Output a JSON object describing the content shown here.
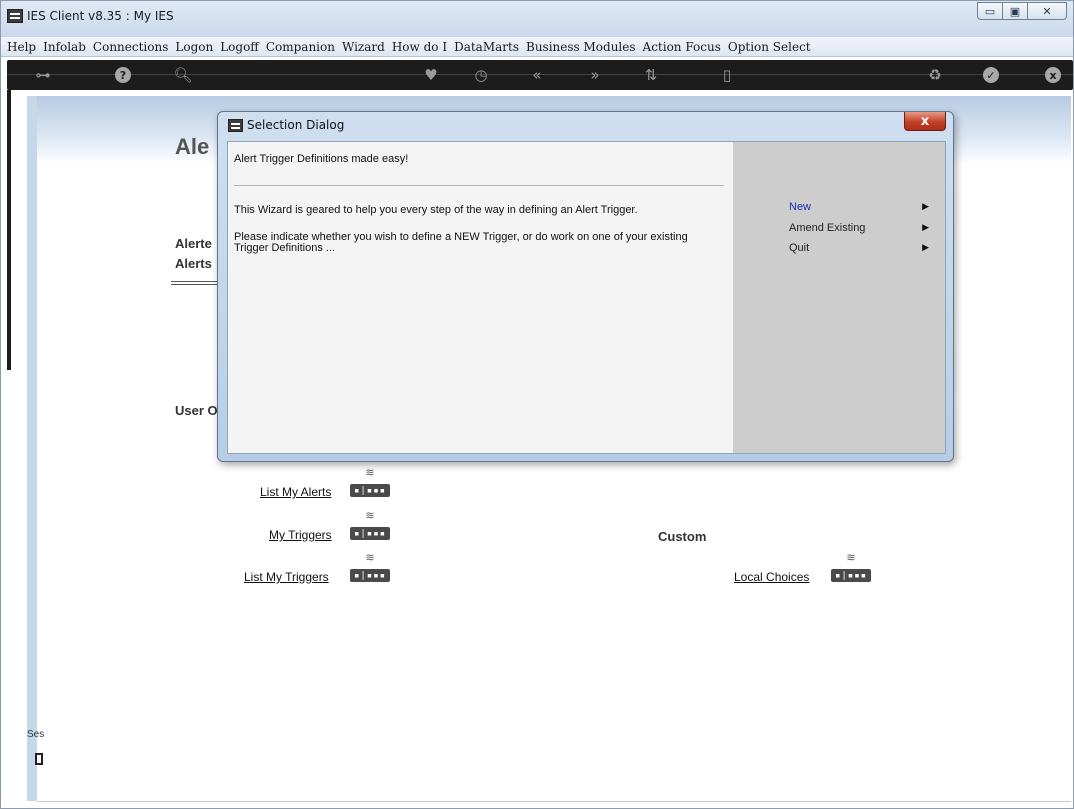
{
  "window": {
    "title": "IES Client v8.35 : My IES",
    "controls": [
      "minimize",
      "maximize",
      "close"
    ]
  },
  "menu": {
    "items": [
      "Help",
      "Infolab",
      "Connections",
      "Logon",
      "Logoff",
      "Companion",
      "Wizard",
      "How do I",
      "DataMarts",
      "Business Modules",
      "Action Focus",
      "Option Select"
    ]
  },
  "toolbar": {
    "icons": [
      "key-icon",
      "help-icon",
      "search-icon",
      "heart-icon",
      "clock-icon",
      "rewind-icon",
      "forward-icon",
      "sort-icon",
      "page-icon",
      "recycle-icon",
      "check-icon",
      "close-icon"
    ]
  },
  "page": {
    "title": "Alerts",
    "title_visible": "Ale",
    "alerted_label": "Alerte",
    "alerts_label": "Alerts",
    "user_options_label": "User O",
    "custom_label": "Custom",
    "links": {
      "list_my_alerts": "List My Alerts",
      "my_triggers": "My Triggers",
      "list_my_triggers": "List My Triggers",
      "local_choices": "Local Choices"
    },
    "router_glyph": "▪|▪▪▪",
    "session_label": "Ses"
  },
  "dialog": {
    "title": "Selection Dialog",
    "close_glyph": "x",
    "heading": "Alert Trigger Definitions made easy!",
    "line1": "This Wizard is geared to help you every step of the way in defining an Alert Trigger.",
    "line2": "Please indicate whether you wish to define a NEW Trigger, or do work on one of your existing",
    "line3": "Trigger Definitions ...",
    "options": [
      {
        "label": "New",
        "active": true
      },
      {
        "label": "Amend Existing",
        "active": false
      },
      {
        "label": "Quit",
        "active": false
      }
    ],
    "arrow": "▶"
  },
  "colors": {
    "toolbar_bg": "#1c1c1c",
    "active_option": "#1c2fb0",
    "dialog_panel_right": "#cdcdcd",
    "close_red": "#c2412a"
  }
}
